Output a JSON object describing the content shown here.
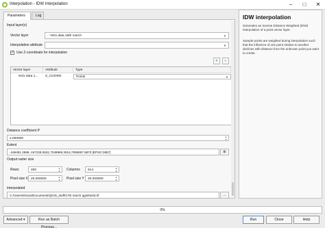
{
  "window": {
    "title": "Interpolation - IDW Interpolation",
    "minimize": "–",
    "maximize": "□",
    "close": "✕"
  },
  "tabs": [
    {
      "label": "Parameters"
    },
    {
      "label": "Log"
    }
  ],
  "form": {
    "input_layers_label": "Input layer(s)",
    "vector_layer_label": "Vector layer",
    "vector_layer_value": "NOx data 18th march",
    "interpolation_attribute_label": "Interpolation attribute",
    "interpolation_attribute_value": "",
    "use_z_label": "Use Z-coordinate for interpolation",
    "use_z_checked": "✓",
    "add_icon": "+",
    "remove_icon": "−",
    "table_headers": [
      "Vector layer",
      "Attribute",
      "Type"
    ],
    "table_rows": [
      {
        "vector_layer": "NOx data 1...",
        "attribute": "Z_COORD",
        "type": "Points"
      }
    ],
    "distance_label": "Distance coefficient P",
    "distance_value": "2.000000",
    "extent_label": "Extent",
    "extent_value": "-169481.3698,-157228.5531,7049869.3616,7058857.5870 [EPSG:3857]",
    "output_raster_label": "Output raster size",
    "rows_label": "Rows",
    "rows_value": "450",
    "columns_label": "Columns",
    "columns_value": "614",
    "pixel_x_label": "Pixel size X",
    "pixel_x_value": "20.000000",
    "pixel_y_label": "Pixel size Y",
    "pixel_y_value": "20.000000",
    "interpolated_label": "Interpolated",
    "interpolated_value": "C:/Users/shona/Documents/QGIS_stuff/17th march qgis/test3.tif",
    "browse_label": "…"
  },
  "help": {
    "title": "IDW interpolation",
    "paragraph1": "Generates an Inverse Distance Weighted (IDW) interpolation of a point vector layer.",
    "paragraph2": "Sample points are weighted during interpolation such that the influence of one point relative to another declines with distance from the unknown point you want to create."
  },
  "progress": {
    "value": 0,
    "label": "0%"
  },
  "buttons": {
    "advanced": "Advanced",
    "batch": "Run as Batch Process...",
    "run": "Run",
    "close": "Close",
    "help": "Help"
  }
}
